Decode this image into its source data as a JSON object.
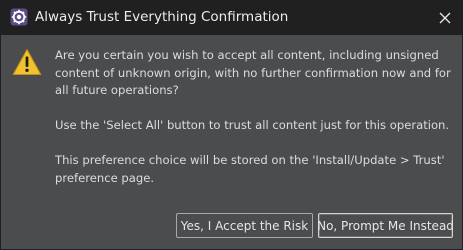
{
  "window": {
    "title": "Always Trust Everything Confirmation",
    "app_icon": "eclipse-gear-icon",
    "close_icon": "close-icon"
  },
  "message": {
    "icon": "warning-icon",
    "paragraphs": [
      "Are you certain you wish to accept all content, including unsigned content of unknown origin, with no further confirmation now and for all future operations?",
      "Use the 'Select All' button to trust all content just for this operation.",
      "This preference choice will be stored on the 'Install/Update > Trust' preference page."
    ]
  },
  "buttons": {
    "accept_label": "Yes, I Accept the Risk",
    "decline_label": "No, Prompt Me Instead"
  },
  "colors": {
    "titlebar": "#202020",
    "body": "#4a4c4e",
    "warning_fill": "#f2c12e"
  }
}
